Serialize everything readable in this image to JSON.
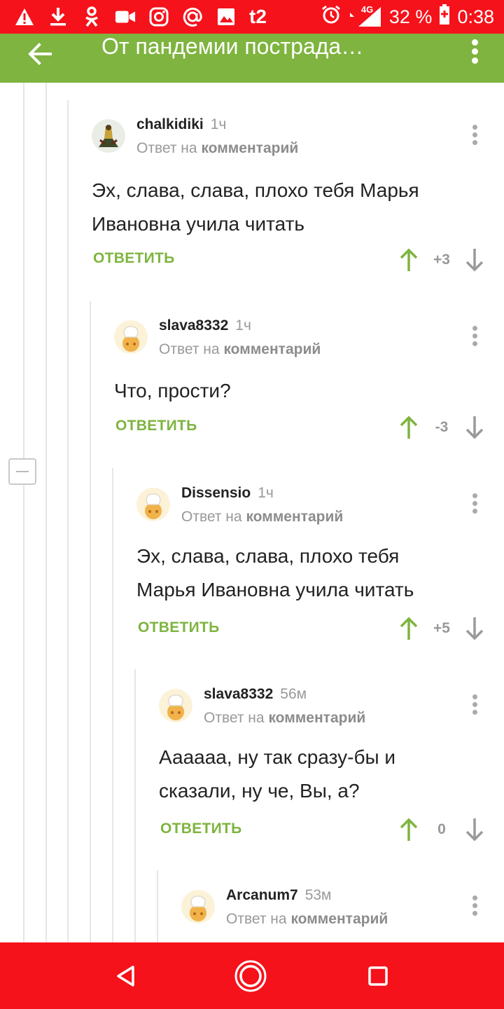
{
  "status_bar": {
    "signal_label": "4G",
    "battery": "32 %",
    "time": "0:38",
    "carrier_logo": "t2",
    "icons": [
      "warning-icon",
      "download-icon",
      "odnoklassniki-icon",
      "video-icon",
      "instagram-icon",
      "at-icon",
      "image-icon",
      "tele2-icon",
      "alarm-icon",
      "signal-icon",
      "battery-icon"
    ]
  },
  "app_bar": {
    "title": "От пандемии пострада…",
    "back_icon": "arrow-left-icon",
    "menu_icon": "more-vertical-icon"
  },
  "comments": [
    {
      "user": "chalkidiki",
      "time": "1ч",
      "reply_prefix": "Ответ на",
      "reply_target": "комментарий",
      "lines": [
        "Эх, слава, слава, плохо тебя Марья",
        "Ивановна учила читать"
      ],
      "reply_label": "ОТВЕТИТЬ",
      "score": "+3",
      "avatar": "user-photo-avatar"
    },
    {
      "user": "slava8332",
      "time": "1ч",
      "reply_prefix": "Ответ на",
      "reply_target": "комментарий",
      "lines": [
        "Что, прости?"
      ],
      "reply_label": "ОТВЕТИТЬ",
      "score": "-3",
      "avatar": "default-chef-avatar"
    },
    {
      "user": "Dissensio",
      "time": "1ч",
      "reply_prefix": "Ответ на",
      "reply_target": "комментарий",
      "lines": [
        "Эх, слава, слава, плохо тебя",
        "Марья Ивановна учила читать"
      ],
      "reply_label": "ОТВЕТИТЬ",
      "score": "+5",
      "avatar": "default-chef-avatar"
    },
    {
      "user": "slava8332",
      "time": "56м",
      "reply_prefix": "Ответ на",
      "reply_target": "комментарий",
      "lines": [
        "Аааааа, ну так сразу-бы и",
        "сказали, ну че, Вы, а?"
      ],
      "reply_label": "ОТВЕТИТЬ",
      "score": "0",
      "avatar": "default-chef-avatar"
    },
    {
      "user": "Arcanum7",
      "time": "53м",
      "reply_prefix": "Ответ на",
      "reply_target": "комментарий",
      "avatar": "default-chef-avatar"
    }
  ],
  "colors": {
    "status_bar": "#f5121b",
    "app_bar": "#7eb43f",
    "accent_green": "#7eb43f",
    "muted_text": "#999999",
    "nav_bar": "#f5121b"
  },
  "nav_bar": {
    "icons": [
      "back-triangle-icon",
      "home-circle-icon",
      "recents-square-icon"
    ]
  }
}
